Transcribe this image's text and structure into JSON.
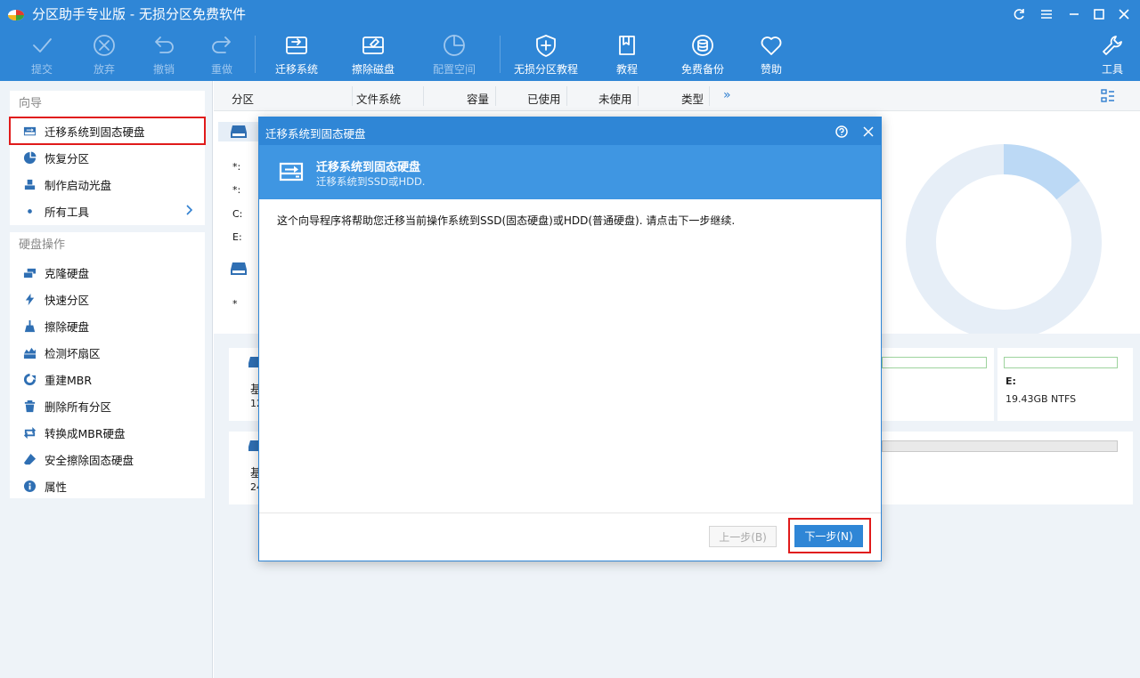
{
  "app": {
    "title": "分区助手专业版 - 无损分区免费软件"
  },
  "toolbar": {
    "items": [
      {
        "label": "提交",
        "icon": "check-icon",
        "enabled": false
      },
      {
        "label": "放弃",
        "icon": "cancel-circle-icon",
        "enabled": false
      },
      {
        "label": "撤销",
        "icon": "undo-icon",
        "enabled": false
      },
      {
        "label": "重做",
        "icon": "redo-icon",
        "enabled": false
      },
      {
        "label": "迁移系统",
        "icon": "migrate-os-icon",
        "enabled": true
      },
      {
        "label": "擦除磁盘",
        "icon": "wipe-disk-icon",
        "enabled": true
      },
      {
        "label": "配置空间",
        "icon": "allocate-space-icon",
        "enabled": false
      },
      {
        "label": "无损分区教程",
        "icon": "shield-plus-icon",
        "enabled": true
      },
      {
        "label": "教程",
        "icon": "book-icon",
        "enabled": true
      },
      {
        "label": "免费备份",
        "icon": "backup-icon",
        "enabled": true
      },
      {
        "label": "赞助",
        "icon": "heart-icon",
        "enabled": true
      }
    ],
    "tools_label": "工具"
  },
  "sidebar": {
    "wizard_title": "向导",
    "wizard_items": [
      {
        "label": "迁移系统到固态硬盘",
        "icon": "migrate-ssd-icon"
      },
      {
        "label": "恢复分区",
        "icon": "recover-partition-icon"
      },
      {
        "label": "制作启动光盘",
        "icon": "bootable-media-icon"
      },
      {
        "label": "所有工具",
        "icon": "all-tools-icon"
      }
    ],
    "disk_ops_title": "硬盘操作",
    "disk_ops_items": [
      {
        "label": "克隆硬盘",
        "icon": "clone-disk-icon"
      },
      {
        "label": "快速分区",
        "icon": "quick-partition-icon"
      },
      {
        "label": "擦除硬盘",
        "icon": "wipe-hdd-icon"
      },
      {
        "label": "检测坏扇区",
        "icon": "bad-sector-icon"
      },
      {
        "label": "重建MBR",
        "icon": "rebuild-mbr-icon"
      },
      {
        "label": "删除所有分区",
        "icon": "delete-all-icon"
      },
      {
        "label": "转换成MBR硬盘",
        "icon": "convert-mbr-icon"
      },
      {
        "label": "安全擦除固态硬盘",
        "icon": "secure-erase-icon"
      },
      {
        "label": "属性",
        "icon": "info-icon"
      }
    ]
  },
  "columns": [
    "分区",
    "文件系统",
    "容量",
    "已使用",
    "未使用",
    "类型"
  ],
  "partitions_top": {
    "disk1_letters": [
      "*:",
      "*:",
      "C:",
      "E:"
    ],
    "disk2_letters": [
      "*"
    ]
  },
  "disk_cards": [
    {
      "prefix": "基",
      "size_prefix": "12",
      "last_part_letter": "E:",
      "last_part_info": "19.43GB NTFS"
    },
    {
      "prefix": "基",
      "size_prefix": "24"
    }
  ],
  "dialog": {
    "title": "迁移系统到固态硬盘",
    "banner_title": "迁移系统到固态硬盘",
    "banner_subtitle": "迁移系统到SSD或HDD.",
    "body": "这个向导程序将帮助您迁移当前操作系统到SSD(固态硬盘)或HDD(普通硬盘). 请点击下一步继续.",
    "prev_label": "上一步(B)",
    "next_label": "下一步(N)"
  },
  "colors": {
    "brand_blue": "#2f86d6",
    "banner_blue": "#3f96e2",
    "highlight_red": "#e01b1b"
  }
}
